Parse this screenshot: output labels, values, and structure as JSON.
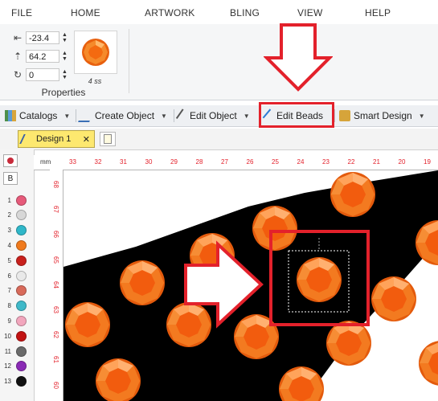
{
  "menu": {
    "items": [
      "FILE",
      "HOME",
      "ARTWORK",
      "BLING",
      "VIEW",
      "HELP"
    ]
  },
  "properties": {
    "group_label": "Properties",
    "fields": [
      {
        "name": "x",
        "icon": "x-position-icon",
        "value": "-23.4"
      },
      {
        "name": "y",
        "icon": "y-position-icon",
        "value": "64.2"
      },
      {
        "name": "rotation",
        "icon": "rotation-icon",
        "value": "0"
      }
    ],
    "bead_size_label": "4 ss"
  },
  "toolbar": {
    "catalogs": "Catalogs",
    "create_object": "Create Object",
    "edit_object": "Edit Object",
    "edit_beads": "Edit Beads",
    "smart_design": "Smart Design"
  },
  "tabs": {
    "design": "Design 1"
  },
  "palette": {
    "top_letter": "B",
    "rows": [
      {
        "num": "1",
        "color": "#e65a7a"
      },
      {
        "num": "2",
        "color": "#d7d7d7"
      },
      {
        "num": "3",
        "color": "#2fb7c9"
      },
      {
        "num": "4",
        "color": "#f07a1c"
      },
      {
        "num": "5",
        "color": "#c8201c"
      },
      {
        "num": "6",
        "color": "#e9e9e9"
      },
      {
        "num": "7",
        "color": "#d86a5a"
      },
      {
        "num": "8",
        "color": "#3fb9c9"
      },
      {
        "num": "9",
        "color": "#f2a6bd"
      },
      {
        "num": "10",
        "color": "#c21212"
      },
      {
        "num": "11",
        "color": "#6a6a6a"
      },
      {
        "num": "12",
        "color": "#8a2ab5"
      },
      {
        "num": "13",
        "color": "#111111"
      }
    ]
  },
  "ruler": {
    "unit": "mm",
    "h_ticks": [
      "33",
      "32",
      "31",
      "30",
      "29",
      "28",
      "27",
      "26",
      "25",
      "24",
      "23",
      "22",
      "21",
      "20",
      "19"
    ],
    "v_ticks": [
      "68",
      "67",
      "66",
      "65",
      "64",
      "63",
      "62",
      "61",
      "60"
    ]
  },
  "colors": {
    "accent_red": "#e3212b",
    "bead_orange": "#f07a1c",
    "tab_yellow": "#fde86f"
  }
}
